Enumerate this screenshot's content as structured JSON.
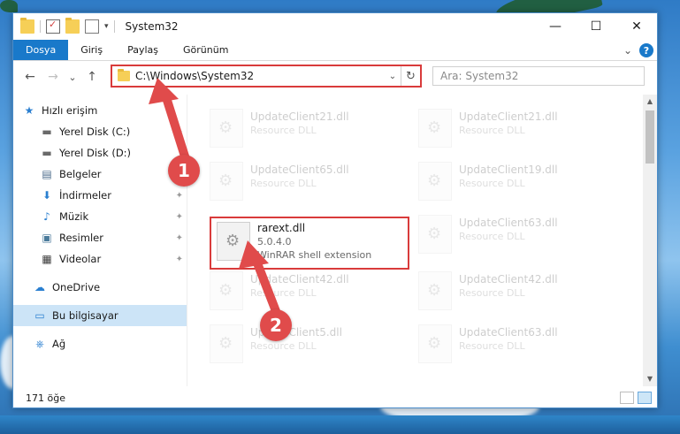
{
  "window": {
    "title": "System32",
    "controls": {
      "minimize": "—",
      "maximize": "☐",
      "close": "✕"
    }
  },
  "ribbon": {
    "tabs": [
      "Dosya",
      "Giriş",
      "Paylaş",
      "Görünüm"
    ],
    "expand_icon": "⌄",
    "help_icon": "?"
  },
  "nav": {
    "back": "←",
    "forward": "→",
    "recent": "⌄",
    "up": "↑",
    "address": "C:\\Windows\\System32",
    "address_drop": "⌄",
    "refresh": "↻",
    "search_placeholder": "Ara: System32"
  },
  "sidebar": {
    "items": [
      {
        "label": "Hızlı erişim",
        "icon": "★"
      },
      {
        "label": "Yerel Disk (C:)",
        "icon": "▬"
      },
      {
        "label": "Yerel Disk (D:)",
        "icon": "▬"
      },
      {
        "label": "Belgeler",
        "icon": "▤"
      },
      {
        "label": "İndirmeler",
        "icon": "⬇"
      },
      {
        "label": "Müzik",
        "icon": "♪"
      },
      {
        "label": "Resimler",
        "icon": "▣"
      },
      {
        "label": "Videolar",
        "icon": "▦"
      },
      {
        "label": "OneDrive",
        "icon": "☁"
      },
      {
        "label": "Bu bilgisayar",
        "icon": "▭"
      },
      {
        "label": "Ağ",
        "icon": "⎈"
      }
    ],
    "pin_icon": "📌"
  },
  "files": [
    {
      "name": "UpdateClient21.dll",
      "desc": "Resource DLL"
    },
    {
      "name": "UpdateClient21.dll",
      "desc": "Resource DLL"
    },
    {
      "name": "UpdateClient65.dll",
      "desc": "Resource DLL"
    },
    {
      "name": "UpdateClient19.dll",
      "desc": "Resource DLL"
    },
    {
      "name": "rarext.dll",
      "version": "5.0.4.0",
      "desc": "WinRAR shell extension"
    },
    {
      "name": "UpdateClient63.dll",
      "desc": "Resource DLL"
    },
    {
      "name": "UpdateClient42.dll",
      "desc": "Resource DLL"
    },
    {
      "name": "UpdateClient42.dll",
      "desc": "Resource DLL"
    },
    {
      "name": "UpdateClient5.dll",
      "desc": "Resource DLL"
    },
    {
      "name": "UpdateClient63.dll",
      "desc": "Resource DLL"
    }
  ],
  "status": {
    "count": "171 öğe"
  },
  "callouts": {
    "one": "1",
    "two": "2"
  },
  "colors": {
    "accent": "#1979ca",
    "highlight_box": "#d93b3b",
    "callout": "#e04b4b",
    "selected_bg": "#cce4f7"
  }
}
